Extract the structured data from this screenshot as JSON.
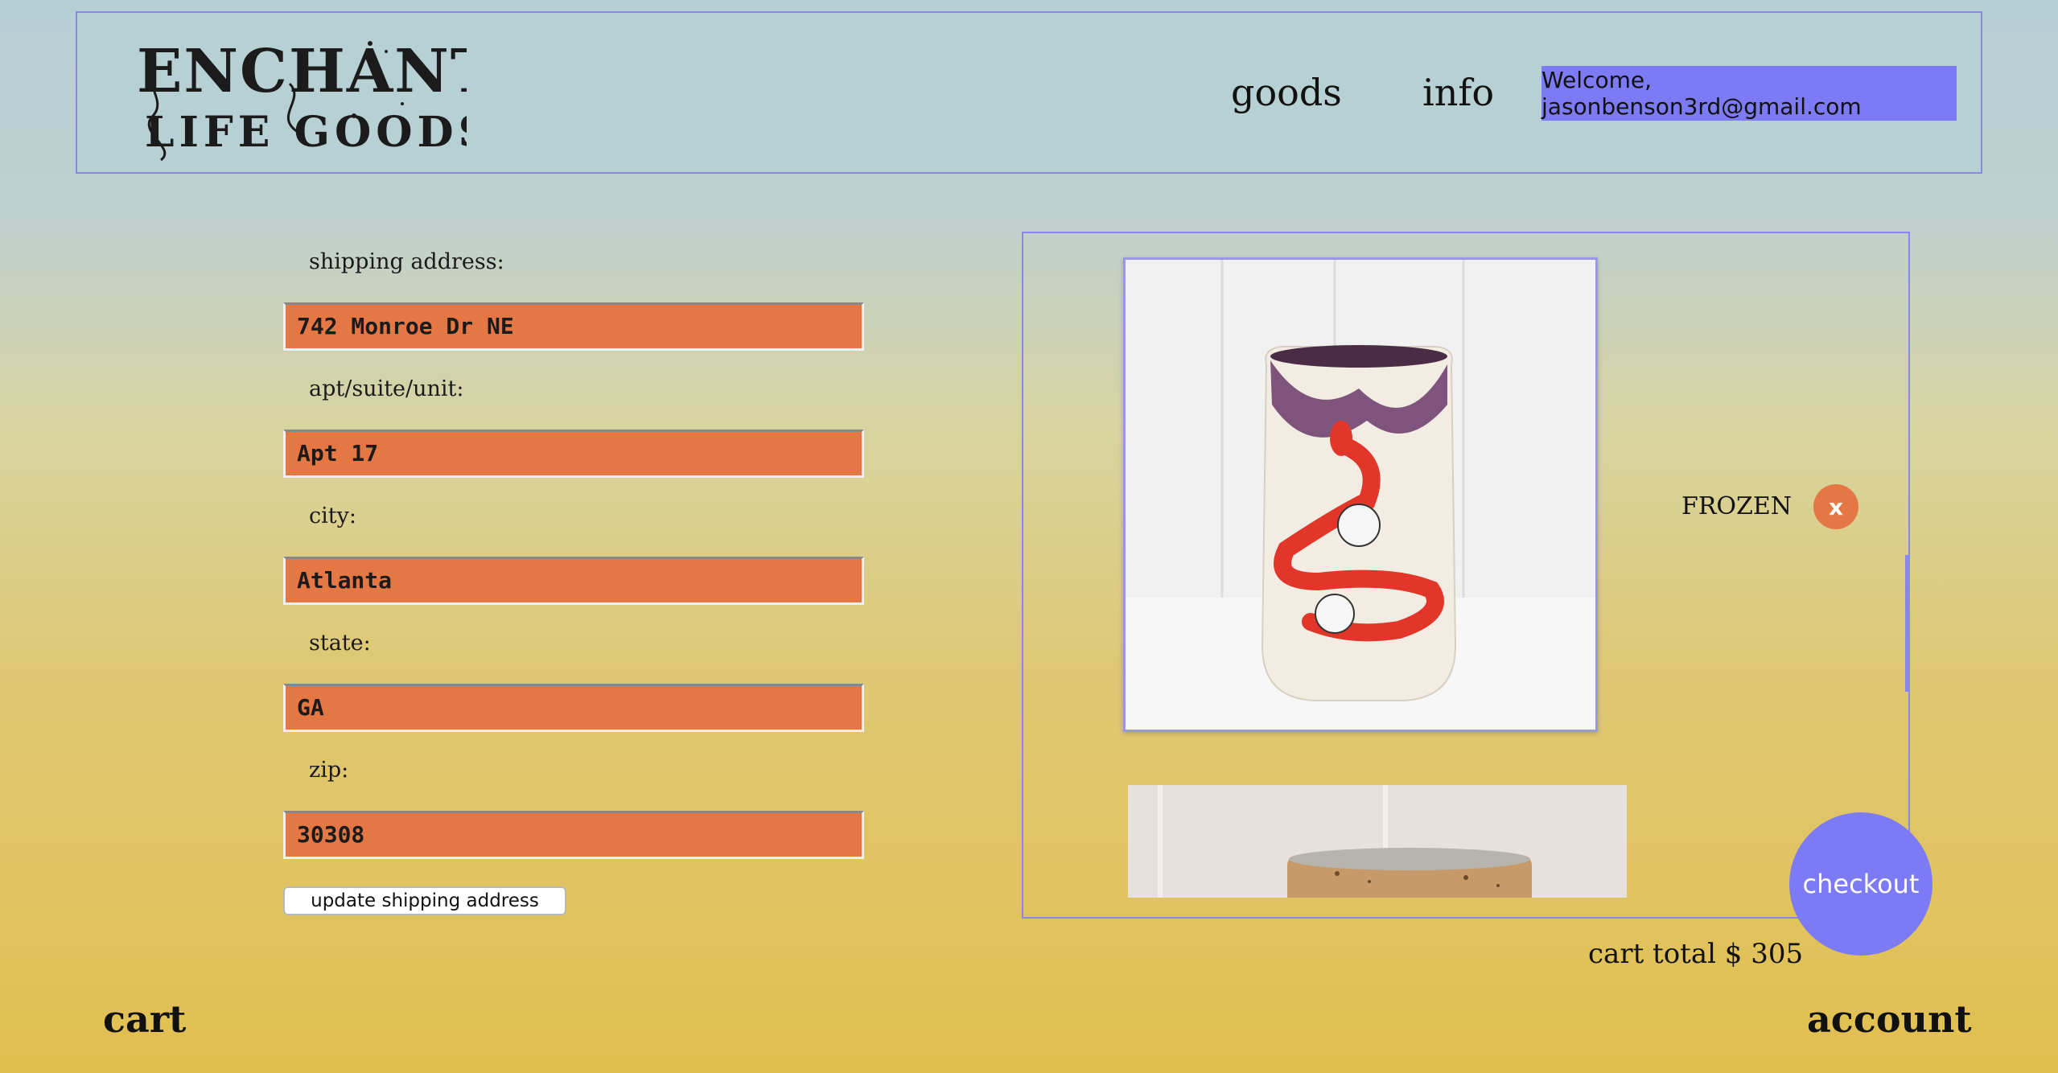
{
  "header": {
    "logo_line1": "ENCHANTED",
    "logo_line2": "LIFE GOODS",
    "nav_goods": "goods",
    "nav_info": "info",
    "welcome": "Welcome, jasonbenson3rd@gmail.com"
  },
  "form": {
    "address_label": "shipping address:",
    "address_value": "742 Monroe Dr NE",
    "apt_label": "apt/suite/unit:",
    "apt_value": "Apt 17",
    "city_label": "city:",
    "city_value": "Atlanta",
    "state_label": "state:",
    "state_value": "GA",
    "zip_label": "zip:",
    "zip_value": "30308",
    "update_button": "update shipping address"
  },
  "cart": {
    "items": [
      {
        "name": "FROZEN",
        "remove_label": "x"
      }
    ],
    "checkout": "checkout",
    "total_label": "cart total $ 305"
  },
  "footer": {
    "cart": "cart",
    "account": "account"
  },
  "colors": {
    "accent_purple": "#7c7af4",
    "input_orange": "#e47744"
  }
}
